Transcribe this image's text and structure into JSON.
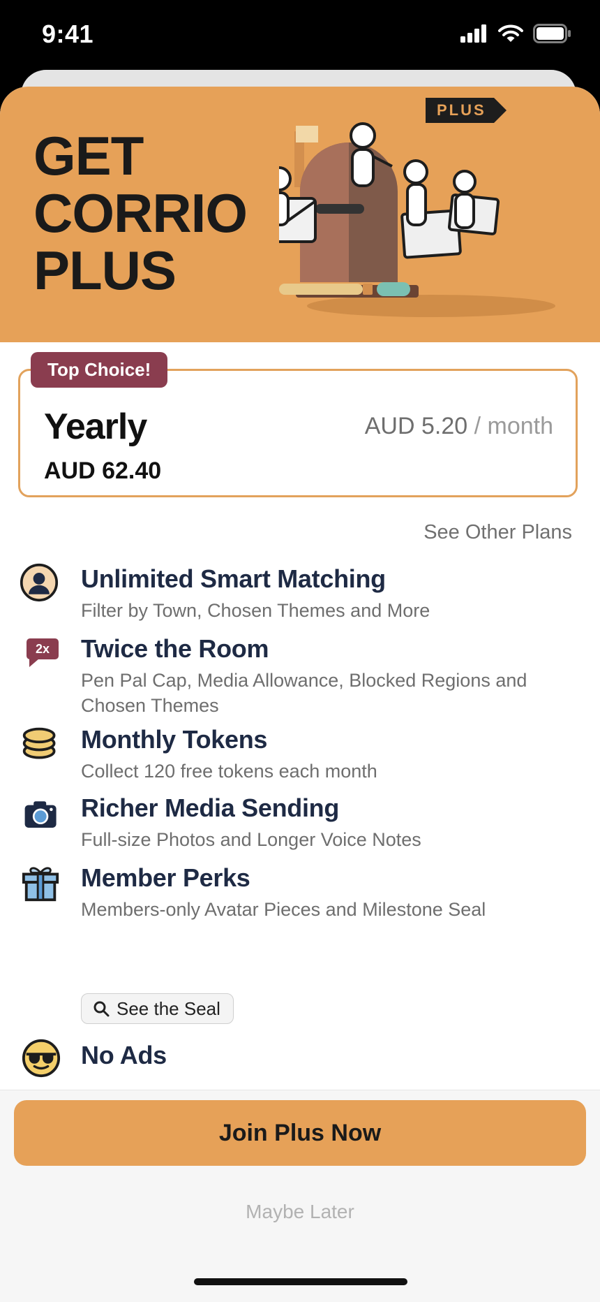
{
  "status_bar": {
    "time": "9:41"
  },
  "hero": {
    "title_lines": [
      "GET",
      "CORRIO",
      "PLUS"
    ],
    "tag": "PLUS",
    "color": "#e6a158"
  },
  "plan": {
    "badge": "Top Choice!",
    "name": "Yearly",
    "total": "AUD 62.40",
    "monthly_price": "AUD 5.20",
    "monthly_sep": "/",
    "monthly_unit": "month"
  },
  "see_other_plans": "See Other Plans",
  "features": [
    {
      "icon": "avatar-icon",
      "title": "Unlimited Smart Matching",
      "desc": "Filter by Town, Chosen Themes and More"
    },
    {
      "icon": "2x-badge-icon",
      "icon_text": "2x",
      "title": "Twice the Room",
      "desc": "Pen Pal Cap, Media Allowance, Blocked Regions and Chosen Themes"
    },
    {
      "icon": "coins-icon",
      "title": "Monthly Tokens",
      "desc": "Collect 120 free tokens each month"
    },
    {
      "icon": "camera-icon",
      "title": "Richer Media Sending",
      "desc": "Full-size Photos and Longer Voice Notes"
    },
    {
      "icon": "gift-icon",
      "title": "Member Perks",
      "desc": "Members-only Avatar Pieces and Milestone Seal",
      "button": "See the Seal"
    },
    {
      "icon": "sunglasses-face-icon",
      "title": "No Ads",
      "desc": ""
    }
  ],
  "cta": {
    "join": "Join Plus Now",
    "later": "Maybe Later"
  },
  "colors": {
    "accent": "#e6a158",
    "badge": "#8a3d4f",
    "title_text": "#1e2a44"
  }
}
